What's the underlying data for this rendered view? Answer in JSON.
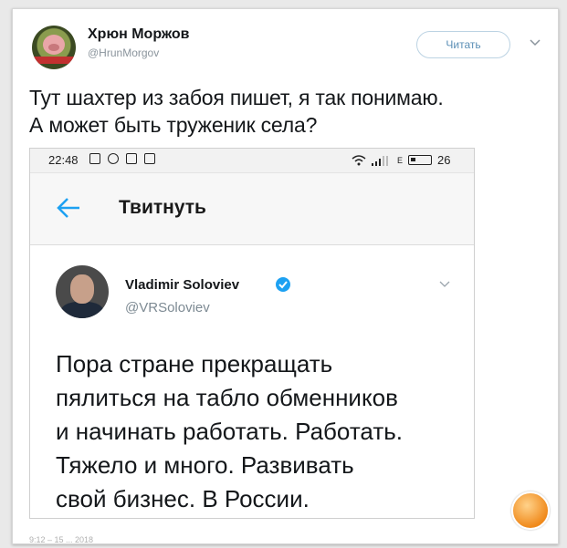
{
  "author": {
    "name": "Хрюн Моржов",
    "handle": "@HrunMorgov",
    "follow_label": "Читать"
  },
  "tweet": {
    "lines": [
      "Тут шахтер из забоя пишет, я так понимаю.",
      "А может быть труженик села?"
    ]
  },
  "screenshot": {
    "status": {
      "time": "22:48",
      "signal_label": "E",
      "battery": "26"
    },
    "header_title": "Твитнуть",
    "quoted": {
      "name": "Vladimir Soloviev",
      "handle": "@VRSoloviev",
      "lines": [
        "Пора стране прекращать",
        "пялиться на табло обменников",
        "и начинать работать. Работать.",
        "Тяжело и много. Развивать",
        "свой бизнес. В России."
      ]
    }
  },
  "footer_date": "9:12 – 15 ... 2018",
  "colors": {
    "follow_text": "#5b8fb6",
    "verified": "#1da1f2",
    "back_arrow": "#1da1f2"
  },
  "icons": [
    "caret-down-icon",
    "back-arrow-icon",
    "verified-icon",
    "wifi-icon",
    "signal-icon",
    "battery-icon",
    "site-logo-icon"
  ]
}
